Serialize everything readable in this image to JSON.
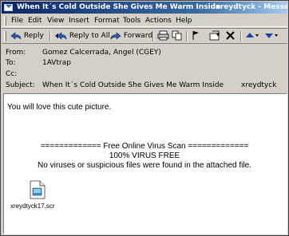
{
  "window": {
    "title": "When It´s Cold Outside She Gives Me Warm Inside",
    "title_right": "xreydtyck - Message"
  },
  "menu": [
    "File",
    "Edit",
    "View",
    "Insert",
    "Format",
    "Tools",
    "Actions",
    "Help"
  ],
  "toolbar": {
    "reply": "Reply",
    "reply_all": "Reply to All",
    "forward": "Forward"
  },
  "headers": {
    "from_label": "From:",
    "from_value": "Gomez Calcerrada, Angel (CGEY)",
    "to_label": "To:",
    "to_value": "1AVtrap",
    "cc_label": "Cc:",
    "cc_value": "",
    "subject_label": "Subject:",
    "subject_value": "When It´s Cold Outside She Gives Me Warm Inside",
    "subject_extra": "xreydtyck"
  },
  "body": {
    "line1": "You will love this cute picture.",
    "scan_banner": "============= Free Online Virus Scan =============",
    "scan_result": "100% VIRUS FREE",
    "scan_detail": "No viruses or suspicious files were found in the attached file."
  },
  "attachment": {
    "filename": "xreydtyck17.scr",
    "icon": "file-icon"
  },
  "colors": {
    "titlebar_start": "#0a246a",
    "titlebar_end": "#a6caf0",
    "chrome": "#d4d0c8",
    "body_bg": "#ffffff"
  }
}
